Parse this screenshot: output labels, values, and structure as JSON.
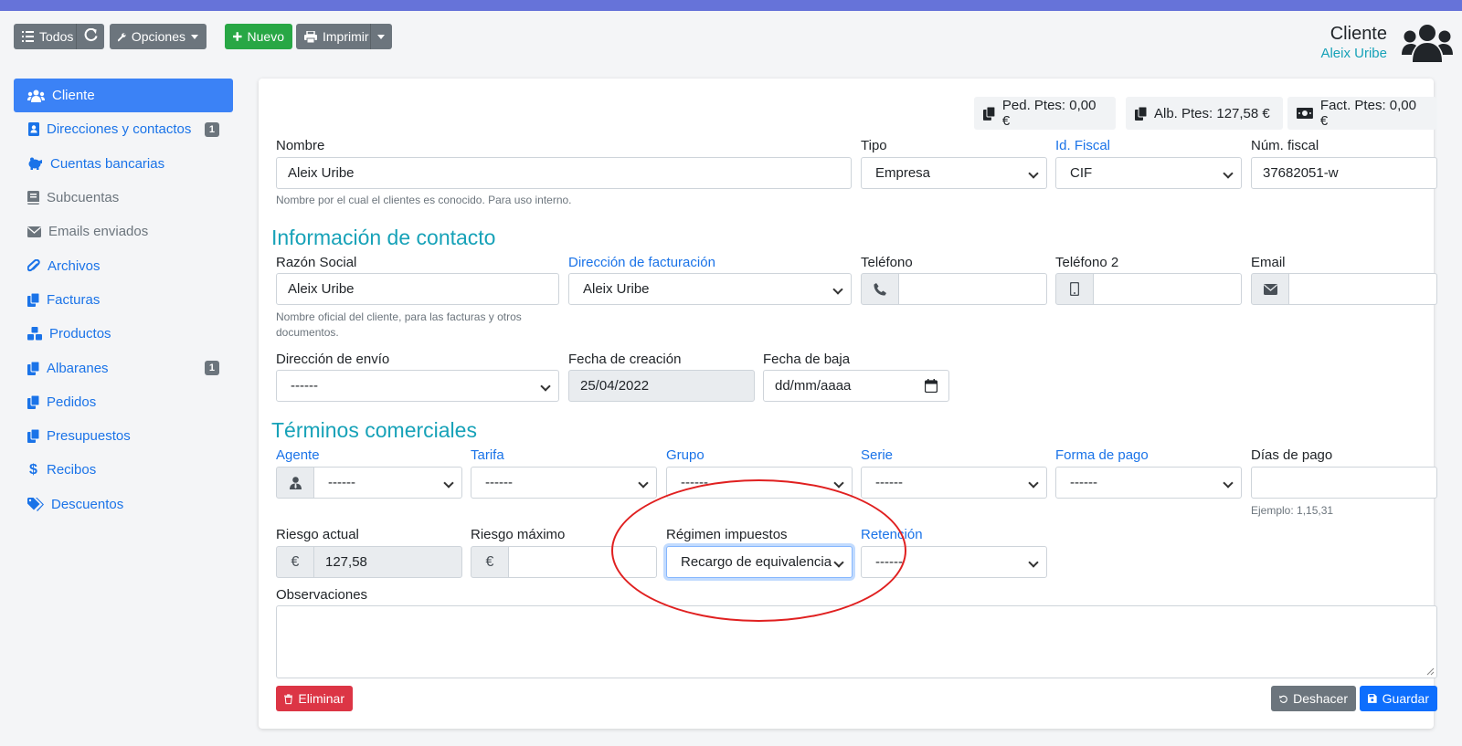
{
  "toolbar": {
    "all_label": "Todos",
    "options_label": "Opciones",
    "new_label": "Nuevo",
    "print_label": "Imprimir"
  },
  "header": {
    "title": "Cliente",
    "subtitle": "Aleix Uribe"
  },
  "sidebar": {
    "items": [
      {
        "label": "Cliente",
        "icon": "users-icon"
      },
      {
        "label": "Direcciones y contactos",
        "icon": "address-book-icon",
        "badge": "1"
      },
      {
        "label": "Cuentas bancarias",
        "icon": "piggy-bank-icon"
      },
      {
        "label": "Subcuentas",
        "icon": "book-icon"
      },
      {
        "label": "Emails enviados",
        "icon": "envelope-icon"
      },
      {
        "label": "Archivos",
        "icon": "paperclip-icon"
      },
      {
        "label": "Facturas",
        "icon": "copy-icon"
      },
      {
        "label": "Productos",
        "icon": "cubes-icon"
      },
      {
        "label": "Albaranes",
        "icon": "copy-icon",
        "badge": "1"
      },
      {
        "label": "Pedidos",
        "icon": "copy-icon"
      },
      {
        "label": "Presupuestos",
        "icon": "copy-icon"
      },
      {
        "label": "Recibos",
        "icon": "dollar-icon"
      },
      {
        "label": "Descuentos",
        "icon": "tags-icon"
      }
    ]
  },
  "pending": {
    "orders": "Ped. Ptes: 0,00 €",
    "delivery": "Alb. Ptes: 127,58 €",
    "invoices": "Fact. Ptes: 0,00 €"
  },
  "form": {
    "nombre_label": "Nombre",
    "nombre_value": "Aleix Uribe",
    "nombre_help": "Nombre por el cual el clientes es conocido. Para uso interno.",
    "tipo_label": "Tipo",
    "tipo_value": "Empresa",
    "idfiscal_label": "Id. Fiscal",
    "idfiscal_value": "CIF",
    "numfiscal_label": "Núm. fiscal",
    "numfiscal_value": "37682051-w",
    "contact_heading": "Información de contacto",
    "razon_label": "Razón Social",
    "razon_value": "Aleix Uribe",
    "razon_help": "Nombre oficial del cliente, para las facturas y otros documentos.",
    "dirfact_label": "Dirección de facturación",
    "dirfact_value": "Aleix Uribe",
    "telefono_label": "Teléfono",
    "telefono2_label": "Teléfono 2",
    "email_label": "Email",
    "direnvio_label": "Dirección de envío",
    "direnvio_value": "------",
    "fechacreacion_label": "Fecha de creación",
    "fechacreacion_value": "25/04/2022",
    "fechabaja_label": "Fecha de baja",
    "fechabaja_placeholder": "dd/mm/aaaa",
    "terms_heading": "Términos comerciales",
    "agente_label": "Agente",
    "agente_value": "------",
    "tarifa_label": "Tarifa",
    "tarifa_value": "------",
    "grupo_label": "Grupo",
    "grupo_value": "------",
    "serie_label": "Serie",
    "serie_value": "------",
    "formapago_label": "Forma de pago",
    "formapago_value": "------",
    "diaspago_label": "Días de pago",
    "diaspago_help": "Ejemplo: 1,15,31",
    "riesgoactual_label": "Riesgo actual",
    "riesgoactual_value": "127,58",
    "riesgomax_label": "Riesgo máximo",
    "currency": "€",
    "regimen_label": "Régimen impuestos",
    "regimen_value": "Recargo de equivalencia",
    "retencion_label": "Retención",
    "retencion_value": "------",
    "observaciones_label": "Observaciones"
  },
  "actions": {
    "delete_label": "Eliminar",
    "undo_label": "Deshacer",
    "save_label": "Guardar"
  },
  "colors": {
    "accent": "#3b82f6",
    "heading": "#17a2b8",
    "topbar": "#6673d9",
    "annotation": "#e02020"
  }
}
